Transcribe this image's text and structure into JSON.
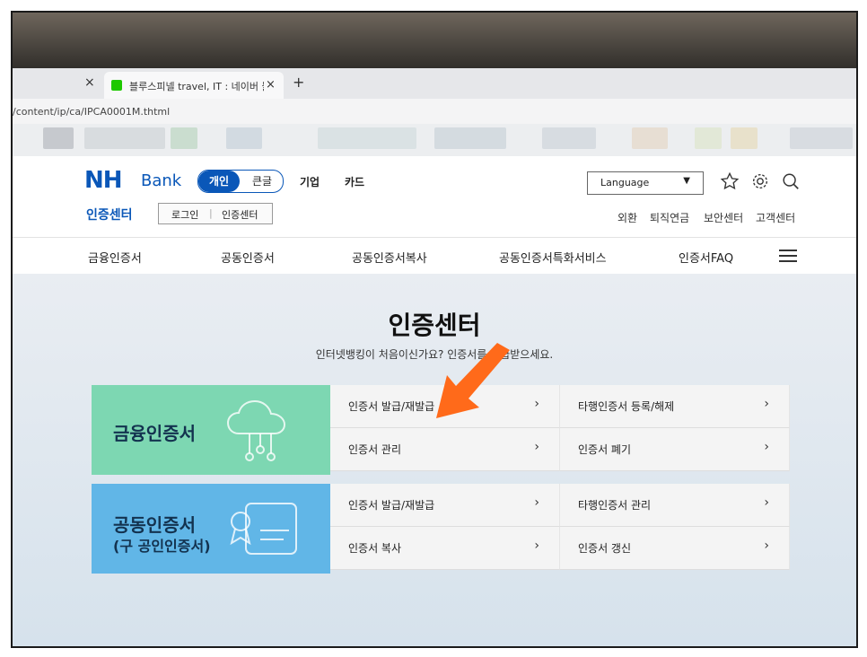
{
  "browser": {
    "tab_title": "블루스피넬 travel, IT : 네이버 블",
    "url": "/content/ip/ca/IPCA0001M.thtml",
    "close_left": "×",
    "tab_close": "×",
    "new_tab": "+"
  },
  "header": {
    "logo": "NH",
    "logo_bank": "Bank",
    "toggle_on": "개인",
    "toggle_off": "큰글",
    "top_links": [
      "기업",
      "카드"
    ],
    "subtitle": "인증센터",
    "login": "로그인",
    "cert_center": "인증센터",
    "language": "Language",
    "util_links": [
      "외환",
      "퇴직연금",
      "보안센터",
      "고객센터"
    ]
  },
  "main_nav": [
    "금융인증서",
    "공동인증서",
    "공동인증서복사",
    "공동인증서특화서비스",
    "인증서FAQ"
  ],
  "hero": {
    "title": "인증센터",
    "subtitle": "인터넷뱅킹이 처음이신가요? 인증서를 발급받으세요."
  },
  "cards": [
    {
      "title": "금융인증서",
      "subtitle": "",
      "items": [
        "인증서 발급/재발급",
        "타행인증서 등록/해제",
        "인증서 관리",
        "인증서 폐기"
      ]
    },
    {
      "title": "공동인증서",
      "subtitle": "(구 공인인증서)",
      "items": [
        "인증서 발급/재발급",
        "타행인증서 관리",
        "인증서 복사",
        "인증서 갱신"
      ]
    }
  ],
  "colors": {
    "brand": "#0a57b8",
    "card_green": "#7dd7b2",
    "card_blue": "#61b6e7",
    "arrow": "#ff6a1a"
  }
}
